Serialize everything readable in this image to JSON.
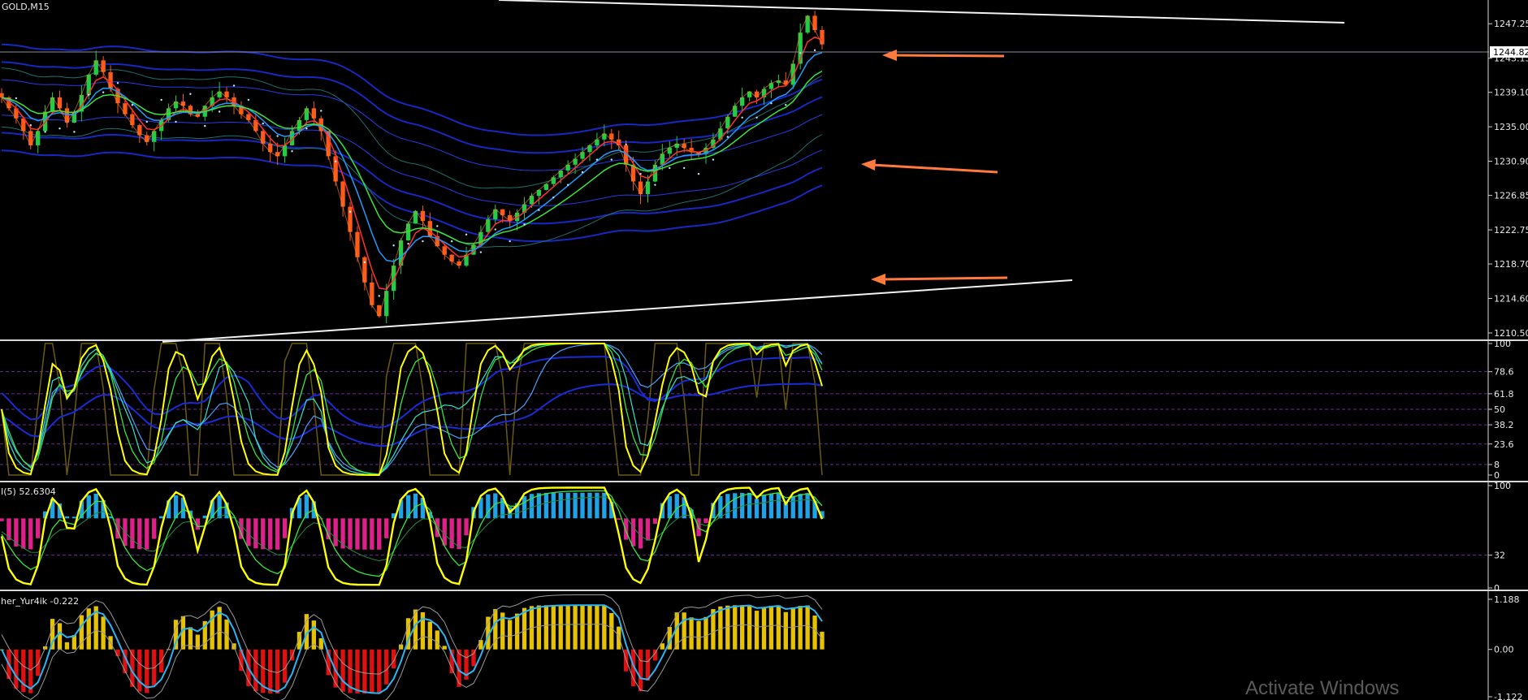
{
  "chart_data": [
    {
      "type": "line",
      "title": "GOLD,M15",
      "ylim": [
        1210.5,
        1249.3
      ],
      "yticks": [
        1247.25,
        1243.15,
        1239.1,
        1235.0,
        1230.9,
        1226.85,
        1222.75,
        1218.7,
        1214.6,
        1210.5
      ],
      "current_price": "1244.82",
      "series": [
        {
          "values": [
            1238.5,
            1237.2,
            1236,
            1234.5,
            1232.8,
            1234.5,
            1236.8,
            1238.5,
            1237.2,
            1235.5,
            1236.8,
            1238.8,
            1241.2,
            1242.9,
            1241.5,
            1239.5,
            1237.8,
            1236.5,
            1235.2,
            1234,
            1233.2,
            1234.5,
            1235.8,
            1237.2,
            1238,
            1237.5,
            1236.5,
            1236.2,
            1237.5,
            1238.5,
            1239.2,
            1238.5,
            1237.5,
            1236.5,
            1235.8,
            1234.5,
            1233,
            1232,
            1231.5,
            1232.8,
            1234.5,
            1235.8,
            1237.2,
            1236,
            1234.5,
            1231.5,
            1228.5,
            1225.5,
            1222.5,
            1219.5,
            1216.5,
            1213.8,
            1212.5,
            1215.5,
            1218.5,
            1221.5,
            1223.5,
            1225,
            1223.8,
            1222,
            1220.8,
            1219.8,
            1219,
            1218.5,
            1219.8,
            1221,
            1222.5,
            1224,
            1225.2,
            1224.5,
            1223.8,
            1224.8,
            1225.8,
            1226.8,
            1227.5,
            1228.2,
            1229,
            1229.8,
            1230.5,
            1231.2,
            1232,
            1232.8,
            1233.5,
            1234.2,
            1233.5,
            1232.8,
            1230.5,
            1228.5,
            1227,
            1228.5,
            1230.5,
            1231.8,
            1232.5,
            1233,
            1232.5,
            1232,
            1231.8,
            1232.5,
            1233.5,
            1234.8,
            1236.2,
            1237.5,
            1238.5,
            1239.2,
            1238.5,
            1239.5,
            1240.2,
            1240.5,
            1240,
            1242.5,
            1246.2,
            1248.2,
            1246.5,
            1244.8
          ]
        }
      ],
      "arrows": 3
    },
    {
      "type": "line",
      "yticks": [
        100,
        78.6,
        61.8,
        50,
        38.2,
        23.6,
        8,
        0
      ],
      "ylim": [
        0,
        100
      ]
    },
    {
      "type": "bar",
      "title": "I(5) 52.6304",
      "yticks": [
        100,
        32,
        0
      ],
      "ylim": [
        0,
        100
      ]
    },
    {
      "type": "bar",
      "title": "her_Yur4ik -0.222",
      "yticks": [
        "1.188",
        "0.00",
        "-1.122"
      ],
      "ylim": [
        -1.122,
        1.188
      ]
    }
  ],
  "watermark": "Activate Windows",
  "colors": {
    "background": "#000000",
    "up_candle": "#22cc44",
    "down_candle": "#ff5a1a",
    "ma_blue": "#1a2bd6",
    "arrow": "#ff7a3c",
    "trendline": "#f2f2f2",
    "yellow": "#ffff00",
    "hist_blue": "#1fa3e6",
    "hist_magenta": "#e0208a",
    "hist_gold": "#e6c200",
    "hist_red": "#e01010",
    "level_line": "#6a2a9a"
  }
}
